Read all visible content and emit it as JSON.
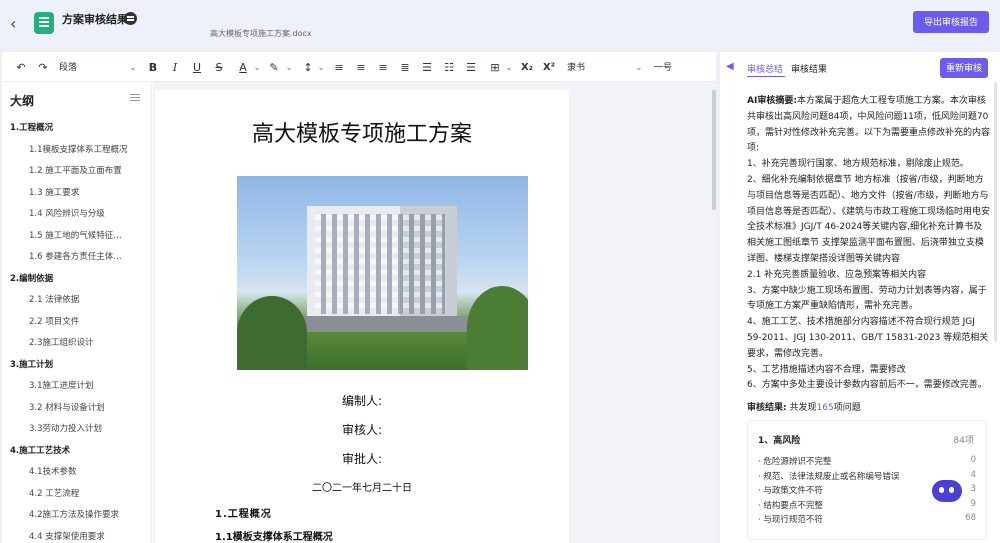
{
  "header": {
    "title": "方案审核结果",
    "file_name": "高大模板专项施工方案.docx",
    "export_label": "导出审核报告"
  },
  "toolbar": {
    "paragraph_style": "段落",
    "bold": "B",
    "italic": "I",
    "underline": "U",
    "strike": "S",
    "font_color": "A",
    "subscript": "X₂",
    "superscript": "X²",
    "font_family": "隶书",
    "font_size": "一号"
  },
  "outline": {
    "title": "大纲",
    "items": [
      {
        "level": 1,
        "label": "1.工程概况"
      },
      {
        "level": 2,
        "label": "1.1模板支撑体系工程概况"
      },
      {
        "level": 2,
        "label": "1.2 施工平面及立面布置"
      },
      {
        "level": 2,
        "label": "1.3 施工要求"
      },
      {
        "level": 2,
        "label": "1.4 风险辨识与分级"
      },
      {
        "level": 2,
        "label": "1.5 施工地的气候特征和季节性天气"
      },
      {
        "level": 2,
        "label": "1.6 参建各方责任主体单位"
      },
      {
        "level": 1,
        "label": "2.编制依据"
      },
      {
        "level": 2,
        "label": "2.1 法律依据"
      },
      {
        "level": 2,
        "label": "2.2 项目文件"
      },
      {
        "level": 2,
        "label": "2.3施工组织设计"
      },
      {
        "level": 1,
        "label": "3.施工计划"
      },
      {
        "level": 2,
        "label": "3.1施工进度计划"
      },
      {
        "level": 2,
        "label": "3.2 材料与设备计划"
      },
      {
        "level": 2,
        "label": "3.3劳动力投入计划"
      },
      {
        "level": 1,
        "label": "4.施工工艺技术"
      },
      {
        "level": 2,
        "label": "4.1技术参数"
      },
      {
        "level": 2,
        "label": "4.2 工艺流程"
      },
      {
        "level": 2,
        "label": "4.2施工方法及操作要求"
      },
      {
        "level": 2,
        "label": "4.4 支撑架使用要求"
      }
    ]
  },
  "document": {
    "title": "高大模板专项施工方案",
    "editor_label": "编制人:",
    "reviewer_label": "审核人:",
    "approver_label": "审批人:",
    "date": "二〇二一年七月二十日",
    "heading1": "1.工程概况",
    "heading2": "1.1模板支撑体系工程概况"
  },
  "review": {
    "tab_summary": "审核总结",
    "tab_result": "审核结果",
    "rereview_label": "重新审核",
    "summary_title": "AI审核摘要:",
    "summary_intro": "本方案属于超危大工程专项施工方案。本次审核共审核出高风险问题84项，中风险问题11项，低风险问题70项，需针对性修改补充完善。以下为需要重点修改补充的内容项:",
    "summary_lines": [
      "1、补充完善现行国家、地方规范标准，剔除废止规范。",
      "2、细化补充编制依据章节 地方标准（按省/市级，判断地方与项目信息等是否匹配）、地方文件（按省/市级，判断地方与项目信息等是否匹配）、《建筑与市政工程施工现场临时用电安全技术标准》JGJ/T 46-2024等关键内容,细化补充计算书及相关施工图纸章节 支撑架监测平面布置图、后浇带独立支模详图、楼梯支撑架搭设详图等关键内容",
      "2.1 补充完善质量验收、应急预案等相关内容",
      "3、方案中缺少施工现场布置图、劳动力计划表等内容，属于专项施工方案严重缺陷情形，需补充完善。",
      "4、施工工艺、技术措施部分内容描述不符合现行规范 JGJ 59-2011、JGJ 130-2011、GB/T 15831-2023 等规范相关要求，需修改完善。",
      "5、工艺措施描述内容不合理，需要修改",
      "6、方案中多处主要设计参数内容前后不一，需要修改完善。"
    ],
    "result_label": "审核结果:",
    "result_prefix": "共发现",
    "result_count": "165",
    "result_suffix": "项问题",
    "risk_group": {
      "title": "1、高风险",
      "count": "84项",
      "rows": [
        {
          "label": "· 危险源辨识不完整",
          "value": "0"
        },
        {
          "label": "· 规范、法律法规废止或名称编号错误",
          "value": "4"
        },
        {
          "label": "· 与政策文件不符",
          "value": "3"
        },
        {
          "label": "· 结构要点不完整",
          "value": "9"
        },
        {
          "label": "· 与现行规范不符",
          "value": "68"
        }
      ]
    }
  },
  "colors": {
    "accent": "#6b5cf0",
    "logo": "#1fb37a"
  }
}
